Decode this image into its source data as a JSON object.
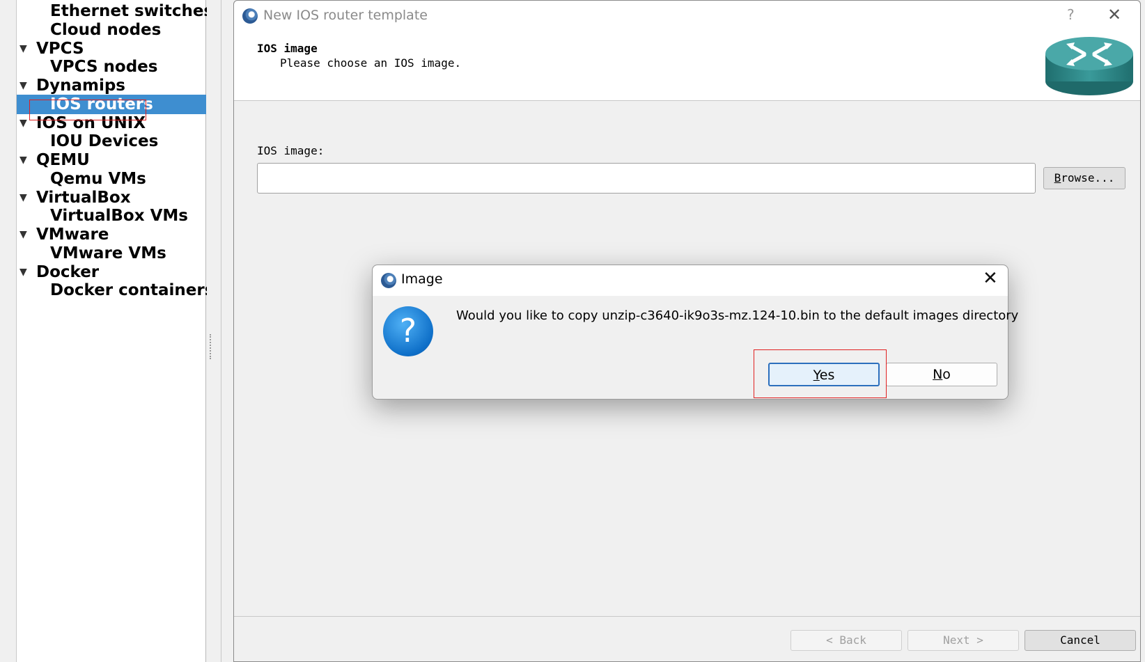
{
  "tree": {
    "items": [
      {
        "label": "Ethernet switches",
        "level": "child",
        "expanded": null,
        "selected": false
      },
      {
        "label": "Cloud nodes",
        "level": "child",
        "expanded": null,
        "selected": false
      },
      {
        "label": "VPCS",
        "level": "parent",
        "expanded": true,
        "selected": false
      },
      {
        "label": "VPCS nodes",
        "level": "child",
        "expanded": null,
        "selected": false
      },
      {
        "label": "Dynamips",
        "level": "parent",
        "expanded": true,
        "selected": false
      },
      {
        "label": "IOS routers",
        "level": "child",
        "expanded": null,
        "selected": true
      },
      {
        "label": "IOS on UNIX",
        "level": "parent",
        "expanded": true,
        "selected": false
      },
      {
        "label": "IOU Devices",
        "level": "child",
        "expanded": null,
        "selected": false
      },
      {
        "label": "QEMU",
        "level": "parent",
        "expanded": true,
        "selected": false
      },
      {
        "label": "Qemu VMs",
        "level": "child",
        "expanded": null,
        "selected": false
      },
      {
        "label": "VirtualBox",
        "level": "parent",
        "expanded": true,
        "selected": false
      },
      {
        "label": "VirtualBox VMs",
        "level": "child",
        "expanded": null,
        "selected": false
      },
      {
        "label": "VMware",
        "level": "parent",
        "expanded": true,
        "selected": false
      },
      {
        "label": "VMware VMs",
        "level": "child",
        "expanded": null,
        "selected": false
      },
      {
        "label": "Docker",
        "level": "parent",
        "expanded": true,
        "selected": false
      },
      {
        "label": "Docker containers",
        "level": "child",
        "expanded": null,
        "selected": false
      }
    ]
  },
  "wizard": {
    "title": "New IOS router template",
    "help_glyph": "?",
    "close_glyph": "✕",
    "header_title": "IOS image",
    "header_subtitle": "Please choose an IOS image.",
    "ios_label": "IOS image:",
    "ios_value": "",
    "browse_label": "Browse...",
    "back_label": "< Back",
    "next_label": "Next >",
    "cancel_label": "Cancel"
  },
  "dialog": {
    "title": "Image",
    "close_glyph": "✕",
    "icon_glyph": "?",
    "message": "Would you like to copy unzip-c3640-ik9o3s-mz.124-10.bin to the default images directory",
    "yes_label": "Yes",
    "no_label": "No"
  },
  "colors": {
    "selection": "#3e8ed0",
    "highlight_outline": "#e02020",
    "router_teal": "#2e8b8b",
    "question_blue": "#0e6fc8"
  }
}
